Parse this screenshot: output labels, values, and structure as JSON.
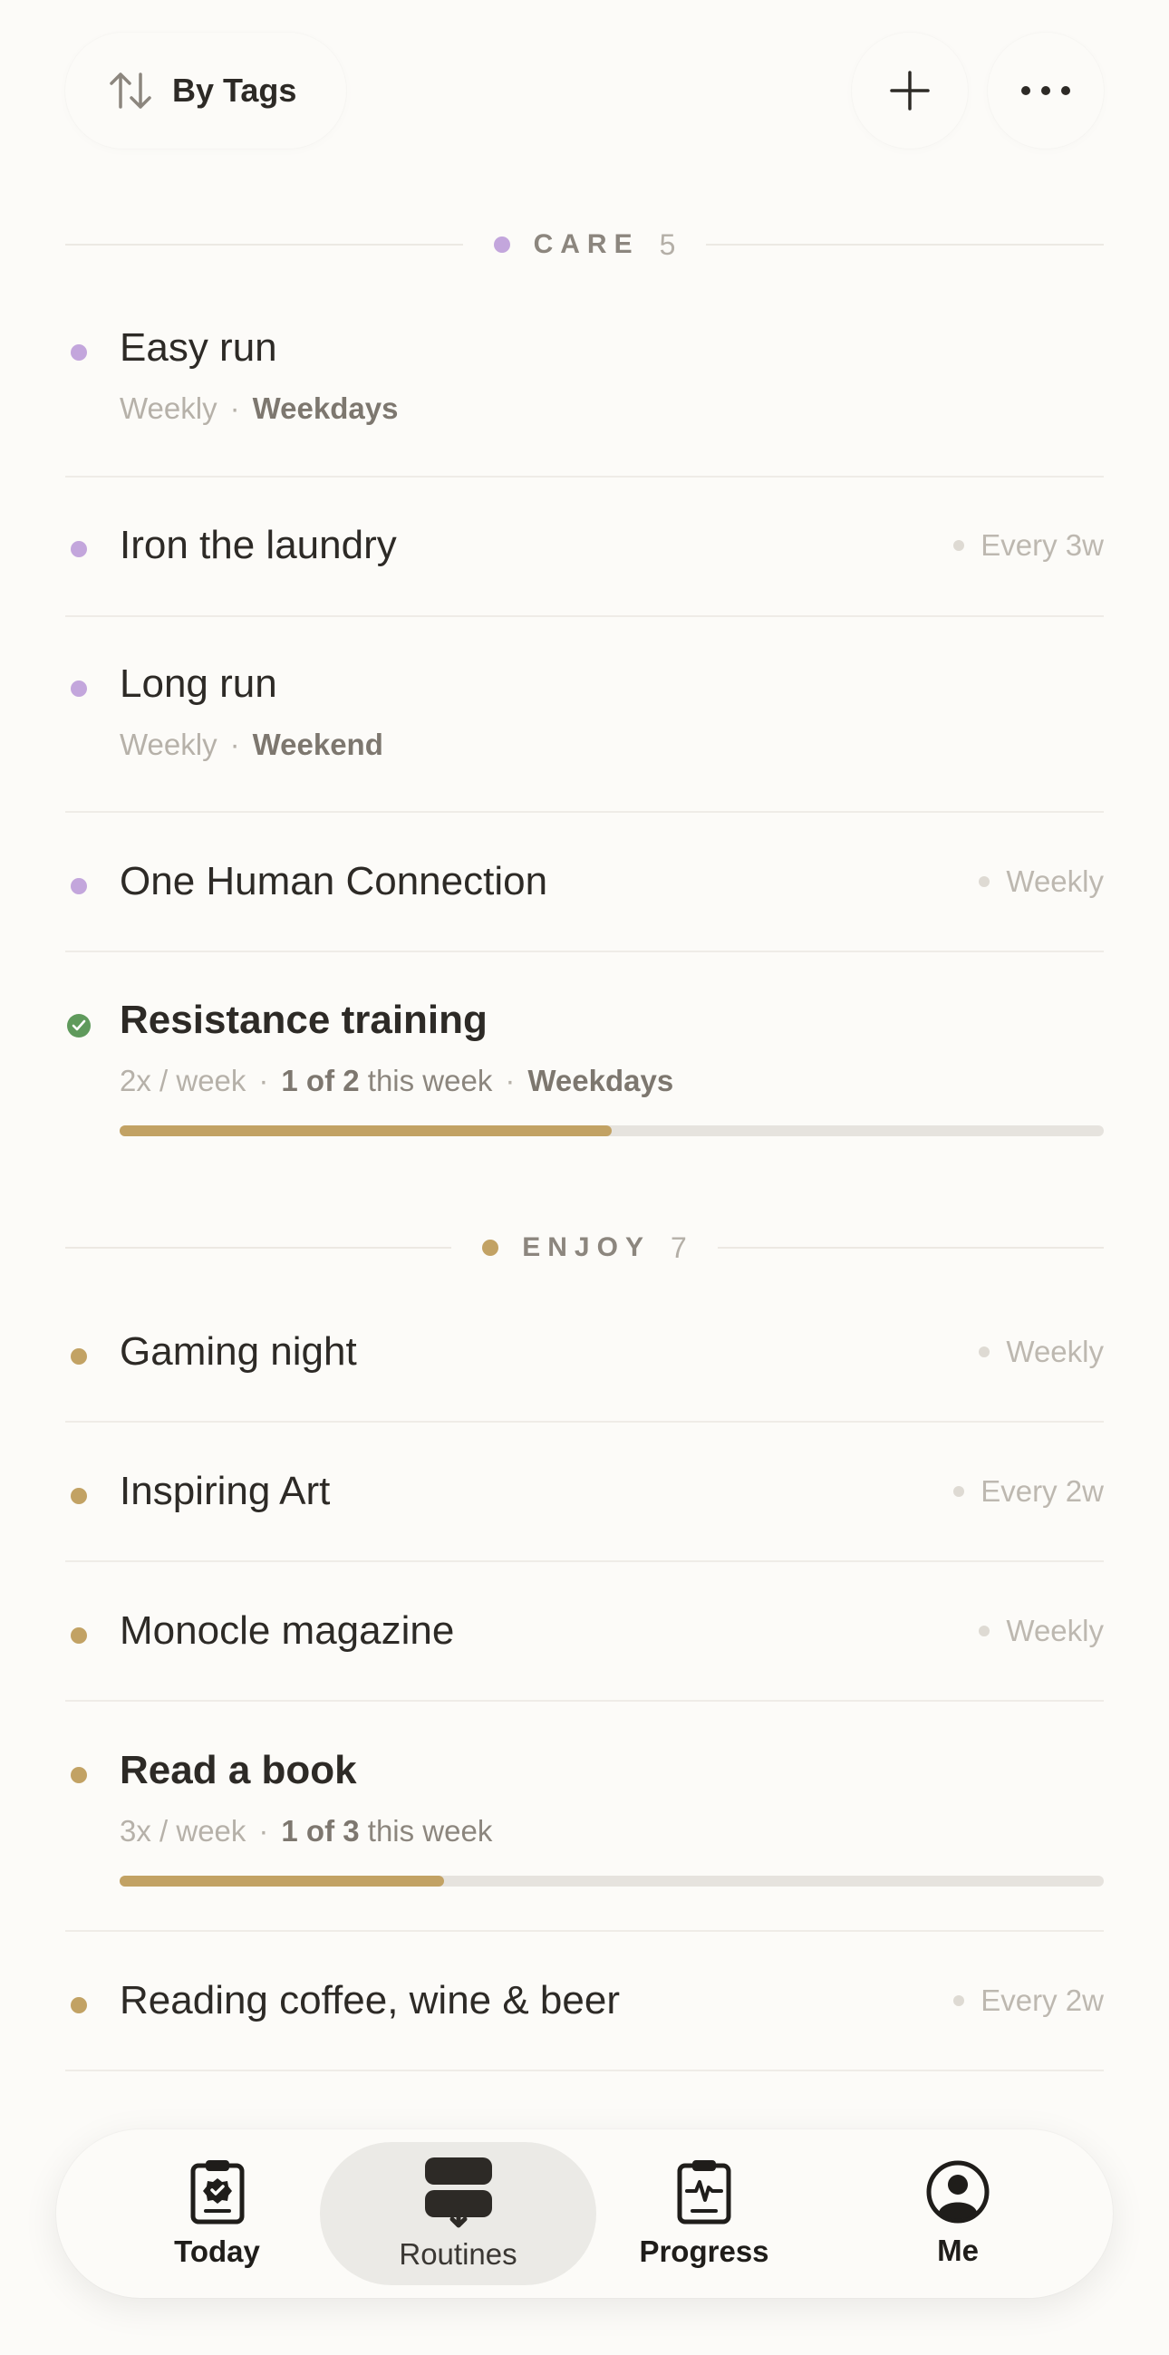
{
  "toolbar": {
    "sort_label": "By Tags",
    "icons": [
      "sort-icon",
      "plus-icon",
      "more-icon"
    ]
  },
  "sections": [
    {
      "name": "CARE",
      "count": "5",
      "color": "#c3a6dc",
      "items": [
        {
          "title": "Easy run",
          "frequency": "Weekly",
          "days": "Weekdays"
        },
        {
          "title": "Iron the laundry",
          "right": "Every 3w"
        },
        {
          "title": "Long run",
          "frequency": "Weekly",
          "days": "Weekend"
        },
        {
          "title": "One Human Connection",
          "right": "Weekly"
        },
        {
          "title": "Resistance training",
          "frequency": "2x / week",
          "progress_count": "1 of 2",
          "progress_suffix": "this week",
          "days": "Weekdays",
          "progress": 0.5,
          "completed": true
        }
      ]
    },
    {
      "name": "ENJOY",
      "count": "7",
      "color": "#c2a264",
      "items": [
        {
          "title": "Gaming night",
          "right": "Weekly"
        },
        {
          "title": "Inspiring Art",
          "right": "Every 2w"
        },
        {
          "title": "Monocle magazine",
          "right": "Weekly"
        },
        {
          "title": "Read a book",
          "frequency": "3x / week",
          "progress_count": "1 of 3",
          "progress_suffix": "this week",
          "progress": 0.33
        },
        {
          "title": "Reading coffee, wine & beer",
          "right": "Every 2w"
        }
      ]
    }
  ],
  "tabs": [
    {
      "label": "Today",
      "icon": "today-icon"
    },
    {
      "label": "Routines",
      "icon": "routines-icon",
      "active": true
    },
    {
      "label": "Progress",
      "icon": "progress-icon"
    },
    {
      "label": "Me",
      "icon": "profile-icon"
    }
  ],
  "colors": {
    "care": "#c3a6dc",
    "enjoy": "#c2a264",
    "done": "#5f9a5c",
    "background": "#fcfbf8"
  }
}
